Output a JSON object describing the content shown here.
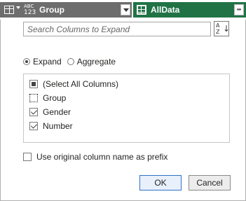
{
  "header": {
    "table_icon": "table-icon",
    "type_icon_line1": "ABC",
    "type_icon_line2": "123",
    "column_name": "Group",
    "dropdown_icon": "chevron-down-icon",
    "table_column_icon": "grid-icon",
    "table_column_name": "AllData",
    "expand_icon": "expand-arrows-icon",
    "expand_glyph": "⇹"
  },
  "dialog": {
    "search": {
      "placeholder": "Search Columns to Expand",
      "value": ""
    },
    "sort_button": {
      "icon": "sort-az-icon",
      "az_top": "A",
      "az_bottom": "Z",
      "arrow": "↓"
    },
    "mode": {
      "options": [
        {
          "label": "Expand",
          "selected": true
        },
        {
          "label": "Aggregate",
          "selected": false
        }
      ]
    },
    "columns": [
      {
        "label": "(Select All Columns)",
        "state": "partial"
      },
      {
        "label": "Group",
        "state": "focused-unchecked"
      },
      {
        "label": "Gender",
        "state": "checked"
      },
      {
        "label": "Number",
        "state": "checked"
      }
    ],
    "prefix_option": {
      "label": "Use original column name as prefix",
      "checked": false
    },
    "buttons": {
      "ok": "OK",
      "cancel": "Cancel"
    }
  },
  "colors": {
    "header_gray": "#6d6d6d",
    "header_green": "#217346",
    "ok_border": "#2e73c9"
  }
}
